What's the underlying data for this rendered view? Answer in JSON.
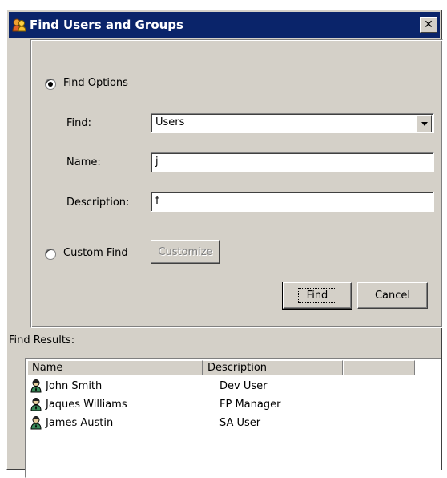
{
  "window": {
    "title": "Find Users and Groups",
    "close_label": "✕"
  },
  "options": {
    "find_options_label": "Find Options",
    "find_label": "Find:",
    "find_value": "Users",
    "name_label": "Name:",
    "name_value": "j",
    "description_label": "Description:",
    "description_value": "f",
    "custom_find_label": "Custom Find",
    "customize_label": "Customize",
    "selected_mode": "Find Options"
  },
  "buttons": {
    "find_label": "Find",
    "cancel_label": "Cancel"
  },
  "results": {
    "label": "Find Results:",
    "columns": [
      "Name",
      "Description",
      ""
    ],
    "rows": [
      {
        "name": "John Smith",
        "description": "Dev User"
      },
      {
        "name": "Jaques Williams",
        "description": "FP Manager"
      },
      {
        "name": "James Austin",
        "description": "SA User"
      }
    ]
  },
  "icons": {
    "app": "users-groups-icon",
    "user": "user-icon",
    "dropdown": "chevron-down-icon"
  },
  "colors": {
    "titlebar": "#0a246a",
    "dialog": "#d4d0c8"
  }
}
